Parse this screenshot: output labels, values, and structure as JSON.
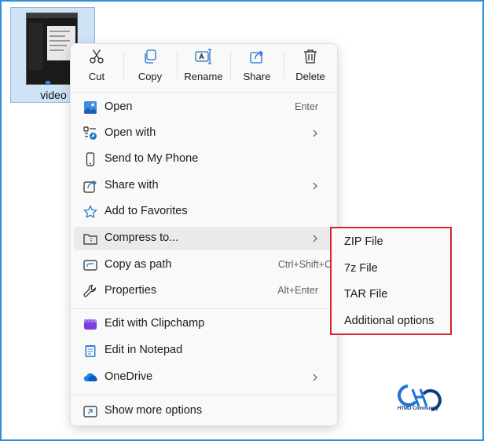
{
  "file": {
    "name": "video"
  },
  "actions": [
    {
      "label": "Cut",
      "icon": "cut-icon"
    },
    {
      "label": "Copy",
      "icon": "copy-icon"
    },
    {
      "label": "Rename",
      "icon": "rename-icon"
    },
    {
      "label": "Share",
      "icon": "share-icon"
    },
    {
      "label": "Delete",
      "icon": "delete-icon"
    }
  ],
  "menu": {
    "items": [
      {
        "label": "Open",
        "shortcut": "Enter",
        "icon": "image-icon"
      },
      {
        "label": "Open with",
        "icon": "open-with-icon",
        "submenu": true
      },
      {
        "label": "Send to My Phone",
        "icon": "phone-icon"
      },
      {
        "label": "Share with",
        "icon": "share-with-icon",
        "submenu": true
      },
      {
        "label": "Add to Favorites",
        "icon": "star-icon"
      },
      {
        "label": "Compress to...",
        "icon": "compress-icon",
        "submenu": true,
        "highlighted": true
      },
      {
        "label": "Copy as path",
        "shortcut": "Ctrl+Shift+C",
        "icon": "copy-path-icon"
      },
      {
        "label": "Properties",
        "shortcut": "Alt+Enter",
        "icon": "wrench-icon"
      },
      {
        "label": "Edit with Clipchamp",
        "icon": "clipchamp-icon"
      },
      {
        "label": "Edit in Notepad",
        "icon": "notepad-icon"
      },
      {
        "label": "OneDrive",
        "icon": "cloud-icon",
        "submenu": true
      },
      {
        "label": "Show more options",
        "icon": "more-options-icon"
      }
    ]
  },
  "submenu": {
    "items": [
      "ZIP File",
      "7z File",
      "TAR File",
      "Additional options"
    ]
  },
  "logo": {
    "text": "HTMD Community"
  },
  "colors": {
    "accent": "#2f7fd6",
    "highlight_border": "#d6262b",
    "frame": "#2f8fd8"
  }
}
